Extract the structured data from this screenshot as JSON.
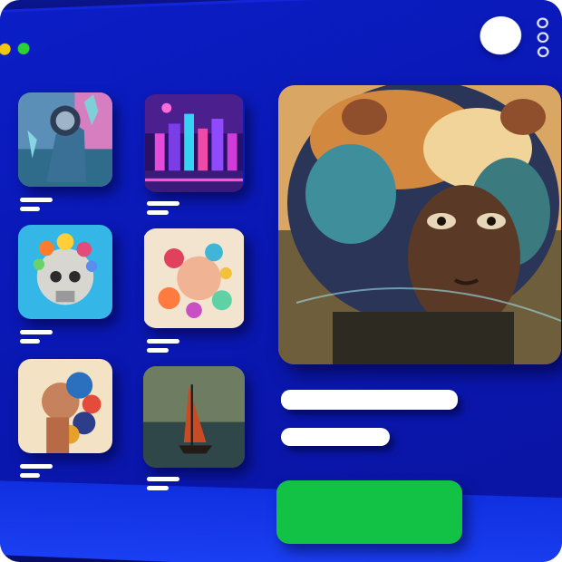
{
  "window": {
    "traffic_lights": {
      "close": "#ff3b3b",
      "minimize": "#f3c613",
      "maximize": "#2ad334"
    },
    "avatar_icon": "user-avatar",
    "menu_icon": "more-vertical"
  },
  "gallery": {
    "thumbnails": [
      {
        "id": "astronaut",
        "theme": "astronaut with crystals"
      },
      {
        "id": "neon-city",
        "theme": "neon city at night"
      },
      {
        "id": "floral-skull",
        "theme": "floral skull"
      },
      {
        "id": "floral-portrait",
        "theme": "floral portrait"
      },
      {
        "id": "floral-bust",
        "theme": "flower bust"
      },
      {
        "id": "sailboat",
        "theme": "sailboat at sea"
      }
    ]
  },
  "detail": {
    "hero_image": "afro-portrait",
    "cta_label": ""
  },
  "colors": {
    "background": "#0a18b4",
    "accent_cta": "#12c245",
    "placeholder": "#ffffff"
  }
}
